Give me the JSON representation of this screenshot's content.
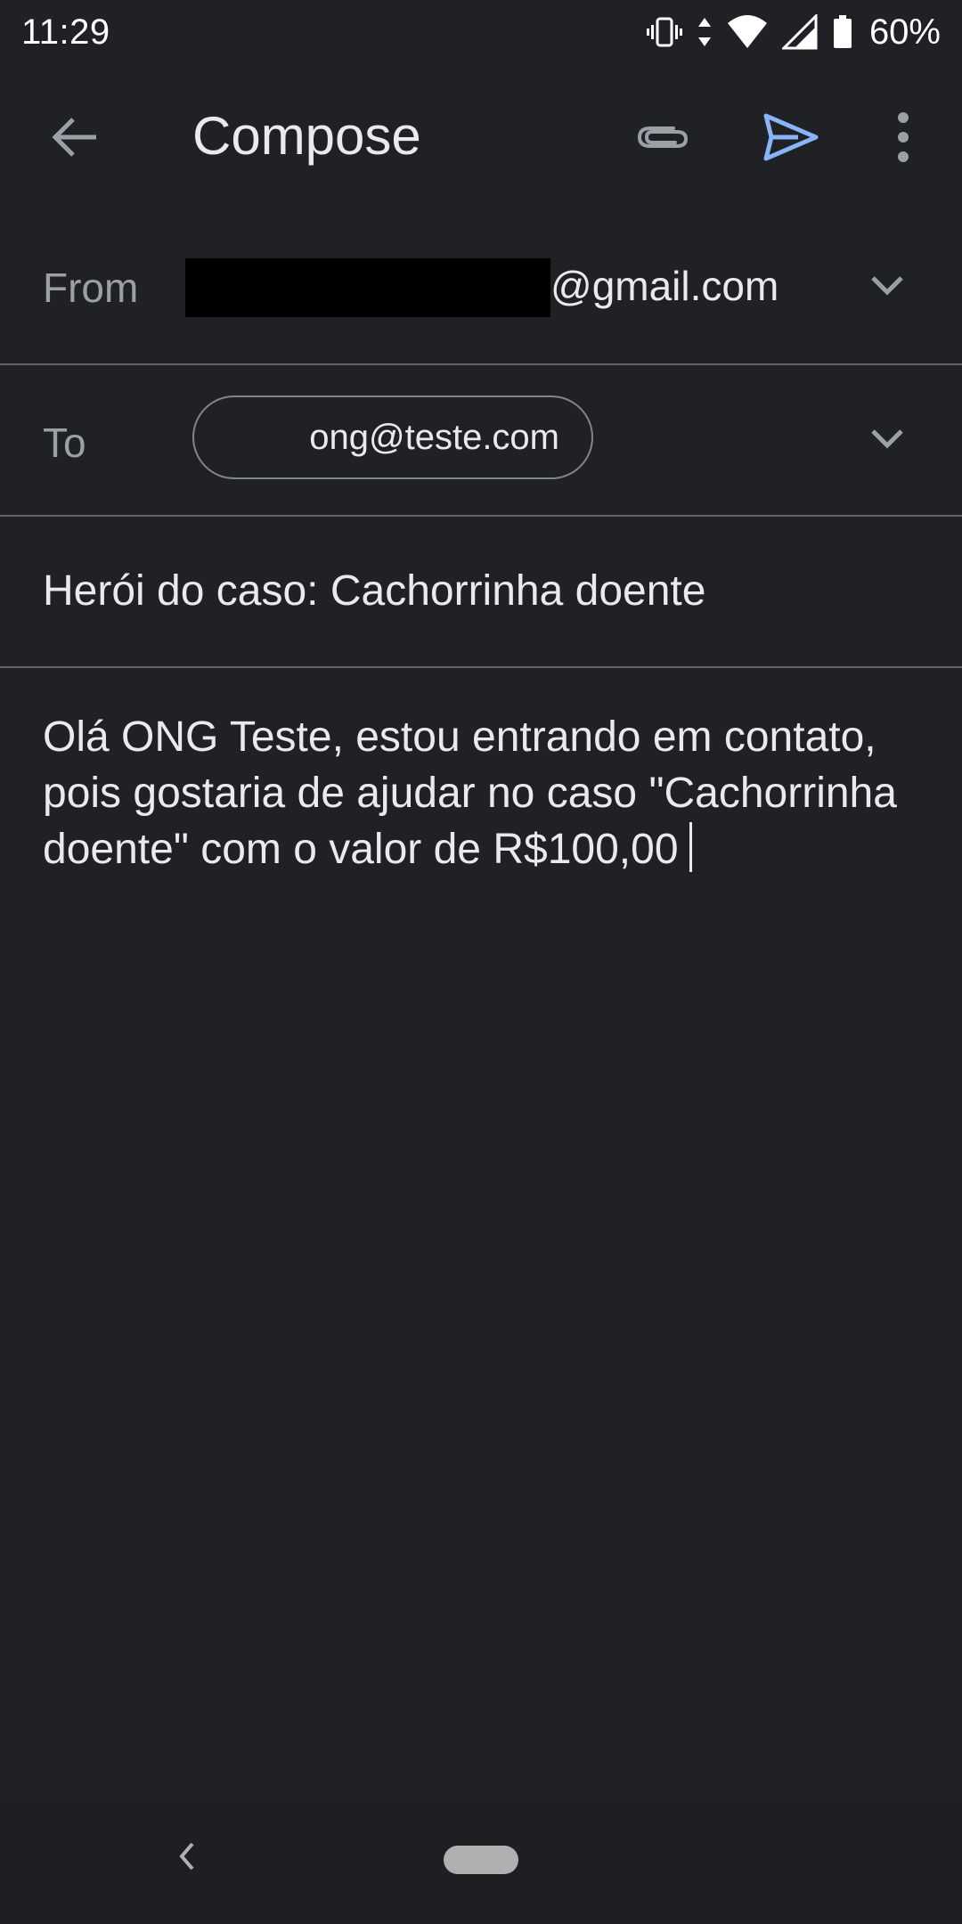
{
  "status_bar": {
    "time": "11:29",
    "battery": "60%",
    "icons": [
      "vibrate-icon",
      "data-arrows-icon",
      "wifi-icon",
      "signal-icon",
      "battery-icon"
    ]
  },
  "app_bar": {
    "title": "Compose",
    "icons": [
      "back-arrow-icon",
      "paperclip-icon",
      "send-icon",
      "more-vert-icon"
    ],
    "send_color": "#8ab4f8"
  },
  "from": {
    "label": "From",
    "address_domain": "@gmail.com"
  },
  "to": {
    "label": "To",
    "recipient": "ong@teste.com"
  },
  "subject": {
    "value": "Herói do caso: Cachorrinha doente"
  },
  "body": {
    "value": "Olá ONG Teste, estou entrando em contato, pois gostaria de ajudar no caso \"Cachorrinha doente\" com o valor de R$100,00"
  },
  "nav_bar": {
    "icons": [
      "nav-back-icon",
      "home-pill"
    ]
  }
}
